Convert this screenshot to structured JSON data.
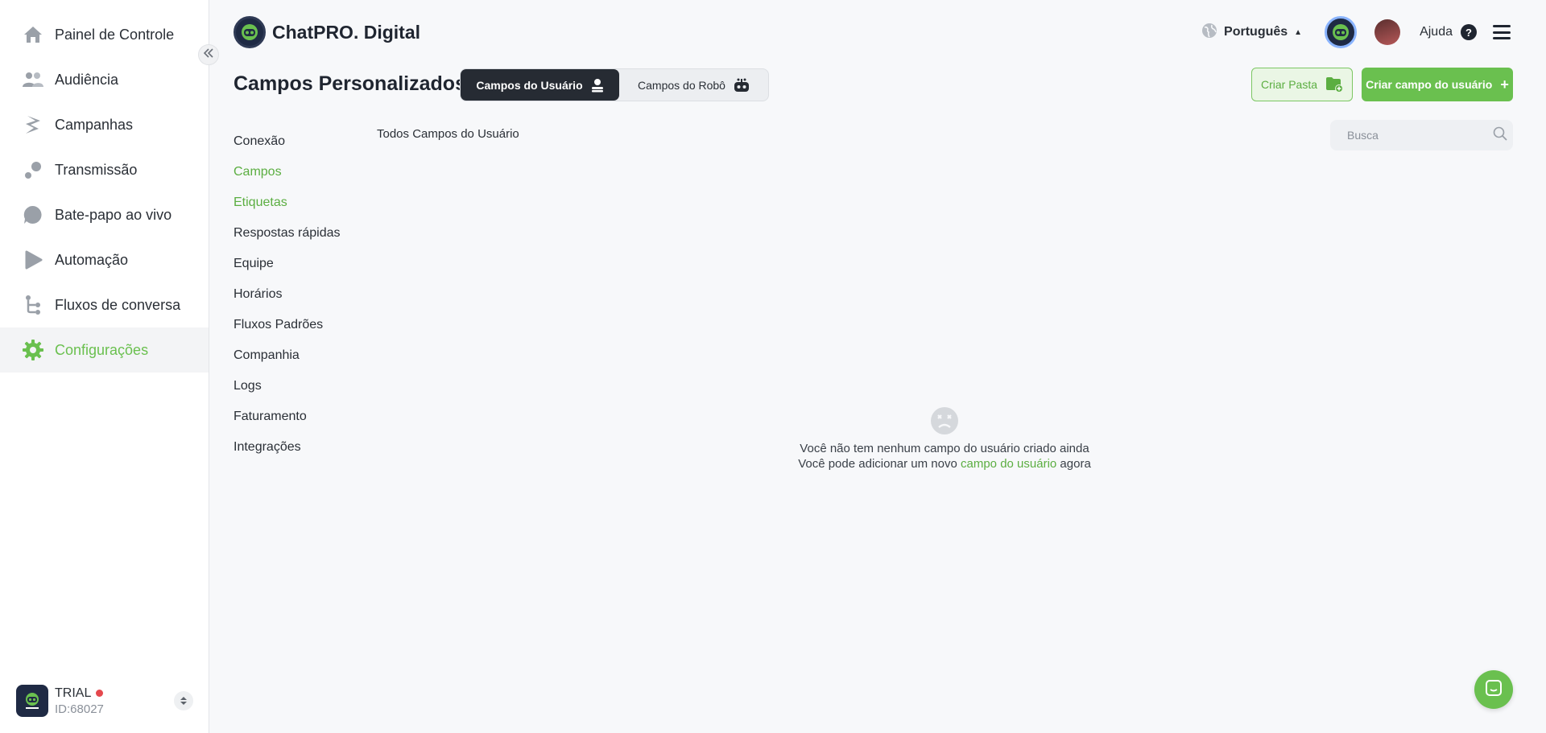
{
  "sidebar": {
    "items": [
      {
        "label": "Painel de Controle",
        "icon": "home-icon"
      },
      {
        "label": "Audiência",
        "icon": "people-icon"
      },
      {
        "label": "Campanhas",
        "icon": "campaign-icon"
      },
      {
        "label": "Transmissão",
        "icon": "broadcast-icon"
      },
      {
        "label": "Bate-papo ao vivo",
        "icon": "chat-bubble-icon"
      },
      {
        "label": "Automação",
        "icon": "play-icon"
      },
      {
        "label": "Fluxos de conversa",
        "icon": "flow-icon"
      },
      {
        "label": "Configurações",
        "icon": "gear-icon",
        "active": true
      }
    ],
    "account": {
      "plan": "TRIAL",
      "id": "ID:68027"
    }
  },
  "header": {
    "brand": "ChatPRO. Digital",
    "language": "Português",
    "help": "Ajuda"
  },
  "page": {
    "title": "Campos Personalizados",
    "segments": [
      {
        "label": "Campos do Usuário",
        "active": true
      },
      {
        "label": "Campos do Robô",
        "active": false
      }
    ],
    "create_folder": "Criar Pasta",
    "create_field": "Criar campo do usuário",
    "breadcrumb": "Todos Campos do Usuário",
    "search_placeholder": "Busca"
  },
  "subnav": {
    "items": [
      {
        "label": "Conexão"
      },
      {
        "label": "Campos",
        "active": true
      },
      {
        "label": "Etiquetas",
        "active": true
      },
      {
        "label": "Respostas rápidas"
      },
      {
        "label": "Equipe"
      },
      {
        "label": "Horários"
      },
      {
        "label": "Fluxos Padrões"
      },
      {
        "label": "Companhia"
      },
      {
        "label": "Logs"
      },
      {
        "label": "Faturamento"
      },
      {
        "label": "Integrações"
      }
    ]
  },
  "empty_state": {
    "line1": "Você não tem nenhum campo do usuário criado ainda",
    "line2_prefix": "Você pode adicionar um novo",
    "line2_link": "campo do usuário",
    "line2_suffix": "agora"
  },
  "colors": {
    "accent": "#6ac04f",
    "dark": "#262b33",
    "status_dot": "#e5484d"
  }
}
